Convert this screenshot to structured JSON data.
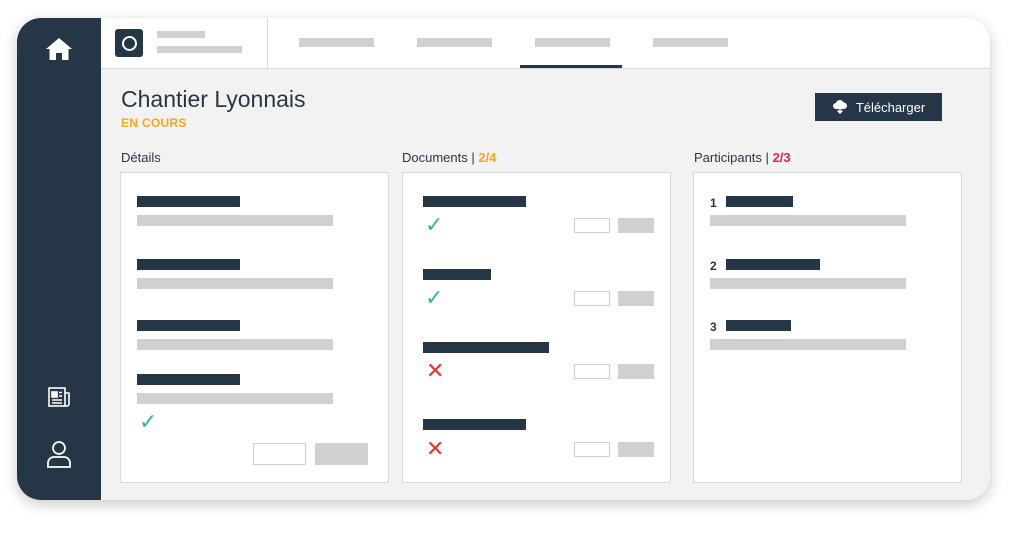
{
  "sidebar": {
    "home_icon": "home-icon",
    "news_icon": "newspaper-icon",
    "user_icon": "user-icon"
  },
  "header": {
    "title": "Chantier Lyonnais",
    "status": "EN COURS",
    "download_label": "Télécharger",
    "download_icon": "cloud-download-icon"
  },
  "sections": {
    "details": {
      "label": "Détails"
    },
    "documents": {
      "label": "Documents",
      "separator": "|",
      "count": "2/4"
    },
    "participants": {
      "label": "Participants",
      "separator": "|",
      "count": "2/3"
    }
  },
  "documents_status": [
    "valid",
    "valid",
    "invalid",
    "invalid"
  ],
  "participants": [
    "1",
    "2",
    "3"
  ],
  "colors": {
    "sidebar": "#253746",
    "accent_orange": "#f5a623",
    "accent_red": "#e0274a",
    "check_green": "#3cb891",
    "cross_red": "#e5352c"
  }
}
